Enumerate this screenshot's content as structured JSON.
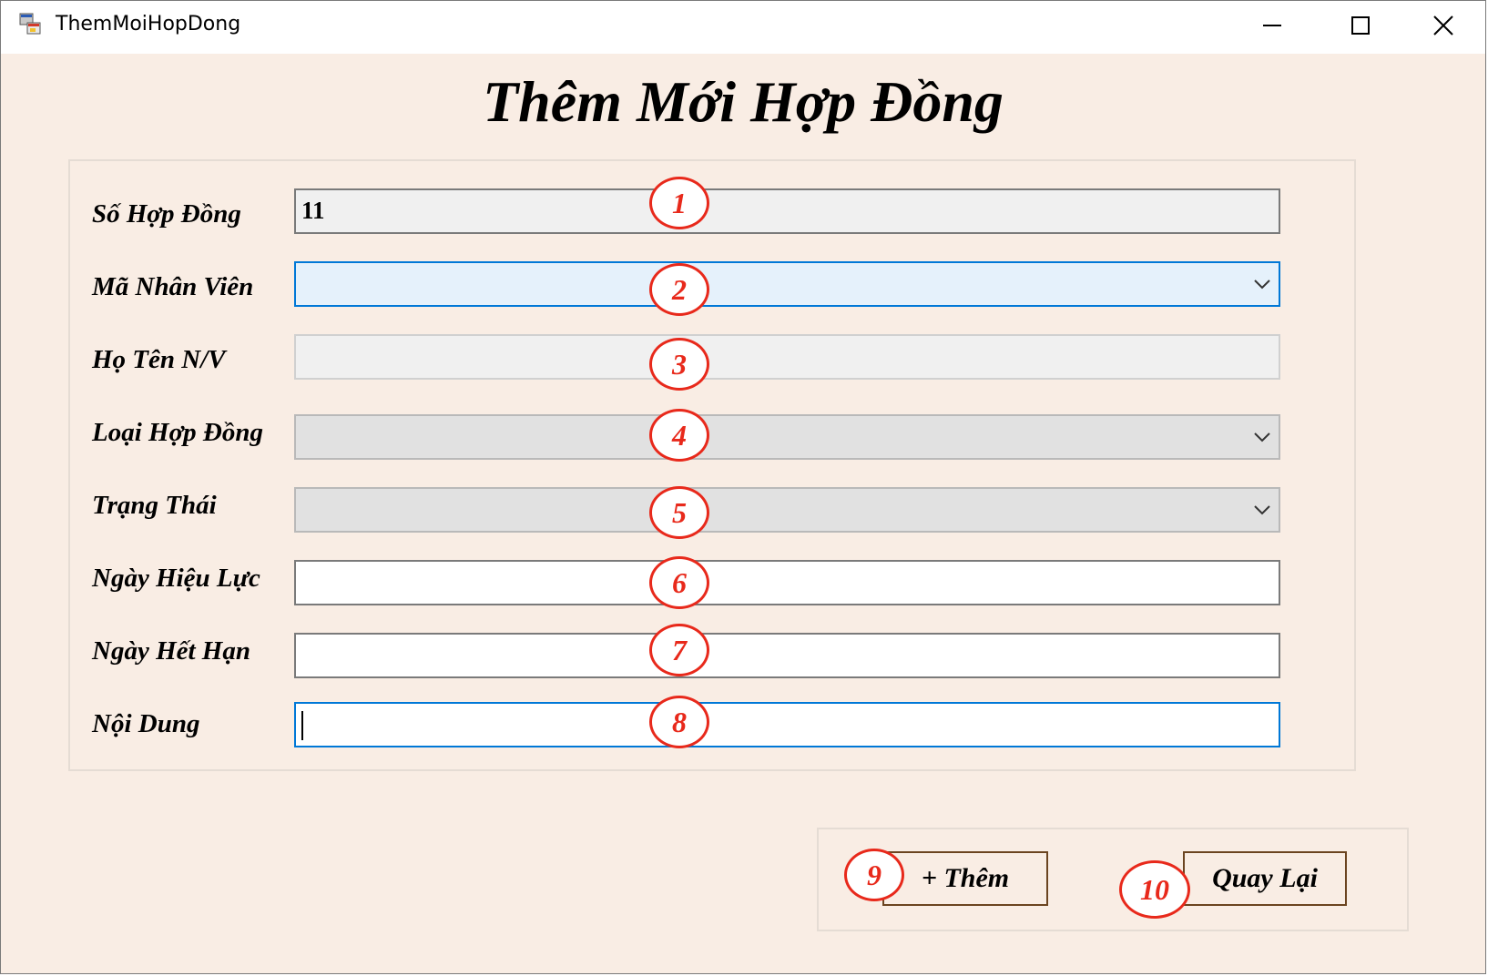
{
  "window": {
    "title": "ThemMoiHopDong",
    "controls": {
      "minimize": "minimize-icon",
      "maximize": "maximize-icon",
      "close": "close-icon"
    }
  },
  "form": {
    "heading": "Thêm Mới Hợp Đồng",
    "fields": {
      "so_hop_dong": {
        "label": "Số Hợp Đồng",
        "value": "11"
      },
      "ma_nhan_vien": {
        "label": "Mã Nhân Viên",
        "value": ""
      },
      "ho_ten_nv": {
        "label": "Họ Tên N/V",
        "value": ""
      },
      "loai_hop_dong": {
        "label": "Loại Hợp Đồng",
        "value": ""
      },
      "trang_thai": {
        "label": "Trạng Thái",
        "value": ""
      },
      "ngay_hieu_luc": {
        "label": "Ngày Hiệu Lực",
        "value": ""
      },
      "ngay_het_han": {
        "label": "Ngày Hết Hạn",
        "value": ""
      },
      "noi_dung": {
        "label": "Nội Dung",
        "value": ""
      }
    }
  },
  "buttons": {
    "them": "+ Thêm",
    "quay_lai": "Quay Lại"
  },
  "annotations": [
    "1",
    "2",
    "3",
    "4",
    "5",
    "6",
    "7",
    "8",
    "9",
    "10"
  ],
  "colors": {
    "form_background": "#f9ede4",
    "annotation_red": "#e8291b",
    "focus_border": "#0078d7",
    "button_border": "#6b4420"
  }
}
